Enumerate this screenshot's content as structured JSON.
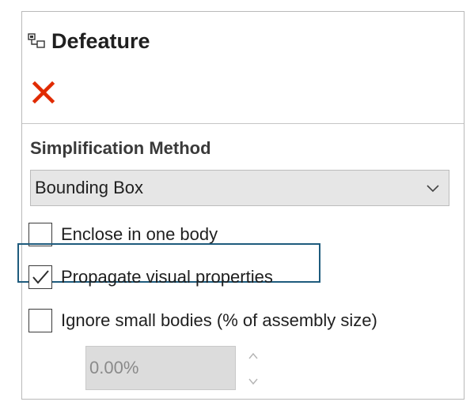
{
  "panel": {
    "title": "Defeature",
    "icons": {
      "feature": "defeature-icon",
      "close": "close-icon"
    },
    "accent_colors": {
      "close": "#e02a00",
      "focus_ring": "#1e5b7d"
    }
  },
  "simplification": {
    "section_title": "Simplification Method",
    "method": {
      "selected": "Bounding Box"
    },
    "options": [
      {
        "label": "Enclose in one body",
        "checked": false
      },
      {
        "label": "Propagate visual properties",
        "checked": true
      },
      {
        "label": "Ignore small bodies (% of assembly size)",
        "checked": false
      }
    ],
    "size_threshold": {
      "value": "0.00%"
    }
  }
}
